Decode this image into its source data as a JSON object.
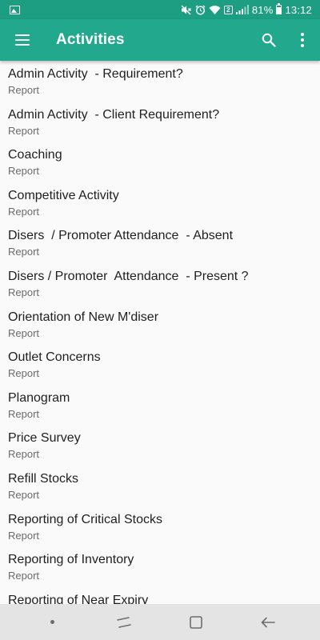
{
  "status_bar": {
    "battery": "81%",
    "time": "13:12",
    "sim_badge": "2",
    "icons": [
      "gallery-icon",
      "mute-icon",
      "alarm-icon",
      "wifi-icon",
      "signal-icon",
      "battery-icon"
    ]
  },
  "toolbar": {
    "title": "Activities",
    "icons": [
      "menu-icon",
      "search-icon",
      "more-vert-icon"
    ]
  },
  "activities": [
    {
      "title": "Admin Activity  - Requirement?",
      "subtitle": "Report"
    },
    {
      "title": "Admin Activity  - Client Requirement?",
      "subtitle": "Report"
    },
    {
      "title": "Coaching",
      "subtitle": "Report"
    },
    {
      "title": "Competitive Activity",
      "subtitle": "Report"
    },
    {
      "title": "Disers  / Promoter Attendance  - Absent",
      "subtitle": "Report"
    },
    {
      "title": "Disers / Promoter  Attendance  - Present ?",
      "subtitle": "Report"
    },
    {
      "title": "Orientation of New M'diser",
      "subtitle": "Report"
    },
    {
      "title": "Outlet Concerns",
      "subtitle": "Report"
    },
    {
      "title": "Planogram",
      "subtitle": "Report"
    },
    {
      "title": "Price Survey",
      "subtitle": "Report"
    },
    {
      "title": "Refill Stocks",
      "subtitle": "Report"
    },
    {
      "title": "Reporting of Critical Stocks",
      "subtitle": "Report"
    },
    {
      "title": "Reporting of Inventory",
      "subtitle": "Report"
    },
    {
      "title": "Reporting of Near Expiry",
      "subtitle": ""
    }
  ],
  "nav_bar": {
    "icons": [
      "nav-dot-icon",
      "recents-icon",
      "home-icon",
      "back-icon"
    ]
  },
  "colors": {
    "status_bar": "#1d9e82",
    "toolbar": "#22a88c",
    "background": "#fafafa",
    "nav_bar": "#e4e4e4"
  }
}
